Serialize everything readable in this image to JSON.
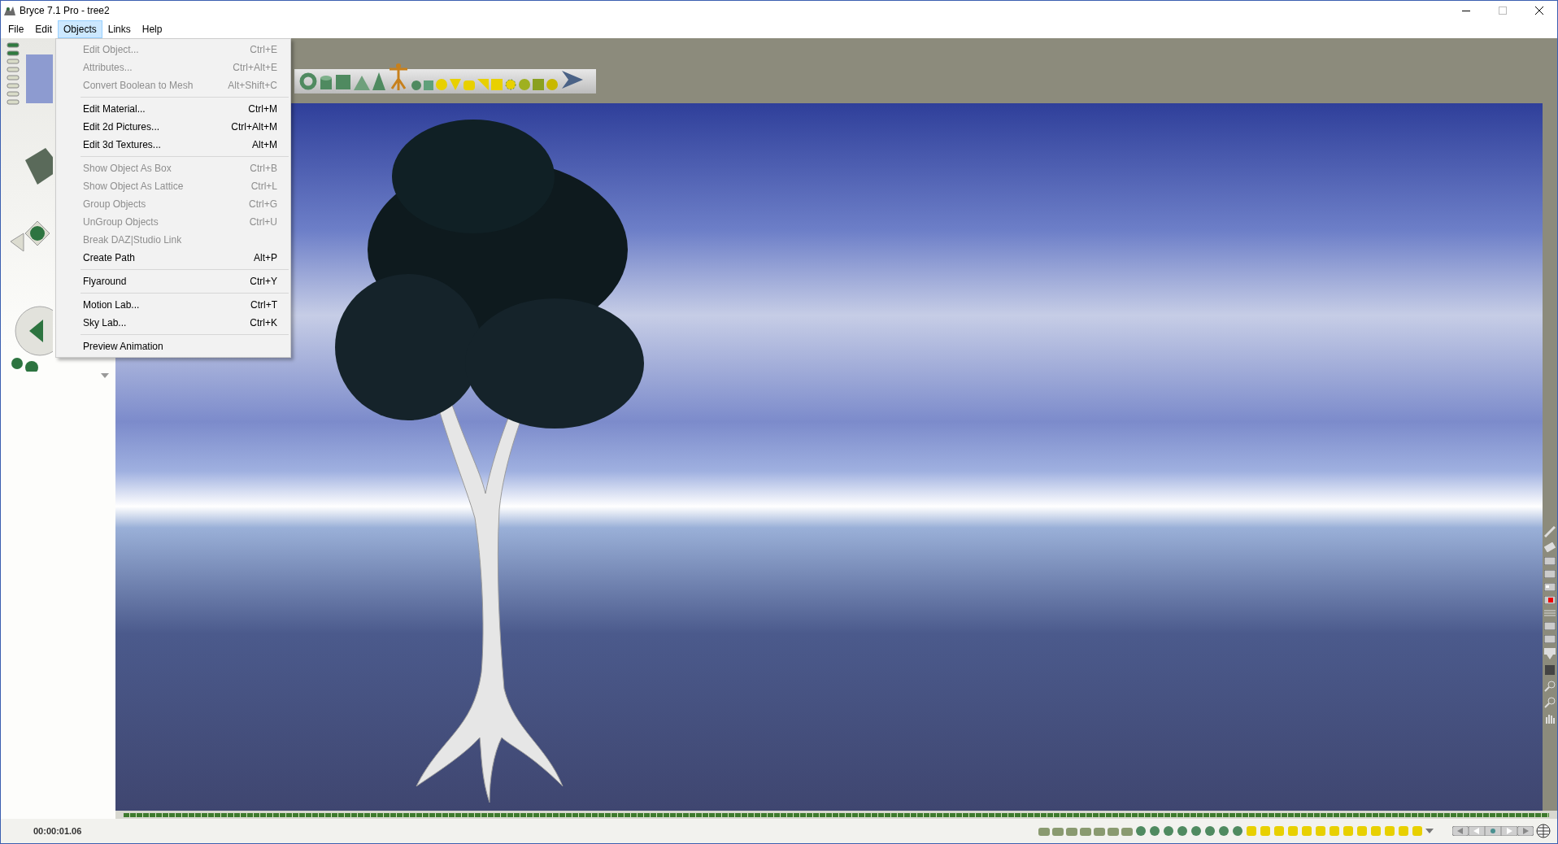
{
  "window": {
    "title": "Bryce 7.1  Pro - tree2"
  },
  "menu_bar": [
    {
      "label": "File",
      "selected": false
    },
    {
      "label": "Edit",
      "selected": false
    },
    {
      "label": "Objects",
      "selected": true
    },
    {
      "label": "Links",
      "selected": false
    },
    {
      "label": "Help",
      "selected": false
    }
  ],
  "objects_menu": [
    {
      "label": "Edit Object...",
      "shortcut": "Ctrl+E",
      "disabled": true,
      "separator_before": false
    },
    {
      "label": "Attributes...",
      "shortcut": "Ctrl+Alt+E",
      "disabled": true,
      "separator_before": false
    },
    {
      "label": "Convert Boolean to Mesh",
      "shortcut": "Alt+Shift+C",
      "disabled": true,
      "separator_before": false
    },
    {
      "label": "Edit Material...",
      "shortcut": "Ctrl+M",
      "disabled": false,
      "separator_before": true
    },
    {
      "label": "Edit 2d Pictures...",
      "shortcut": "Ctrl+Alt+M",
      "disabled": false,
      "separator_before": false
    },
    {
      "label": "Edit 3d Textures...",
      "shortcut": "Alt+M",
      "disabled": false,
      "separator_before": false
    },
    {
      "label": "Show Object As Box",
      "shortcut": "Ctrl+B",
      "disabled": true,
      "separator_before": true
    },
    {
      "label": "Show Object As Lattice",
      "shortcut": "Ctrl+L",
      "disabled": true,
      "separator_before": false
    },
    {
      "label": "Group Objects",
      "shortcut": "Ctrl+G",
      "disabled": true,
      "separator_before": false
    },
    {
      "label": "UnGroup Objects",
      "shortcut": "Ctrl+U",
      "disabled": true,
      "separator_before": false
    },
    {
      "label": "Break DAZ|Studio Link",
      "disabled": true,
      "separator_before": false
    },
    {
      "label": "Create Path",
      "shortcut": "Alt+P",
      "disabled": false,
      "separator_before": false
    },
    {
      "label": "Flyaround",
      "shortcut": "Ctrl+Y",
      "disabled": false,
      "separator_before": true
    },
    {
      "label": "Motion Lab...",
      "shortcut": "Ctrl+T",
      "disabled": false,
      "separator_before": true
    },
    {
      "label": "Sky Lab...",
      "shortcut": "Ctrl+K",
      "disabled": false,
      "separator_before": false
    },
    {
      "label": "Preview Animation",
      "disabled": false,
      "separator_before": true
    }
  ],
  "time_display": "00:00:01.06"
}
